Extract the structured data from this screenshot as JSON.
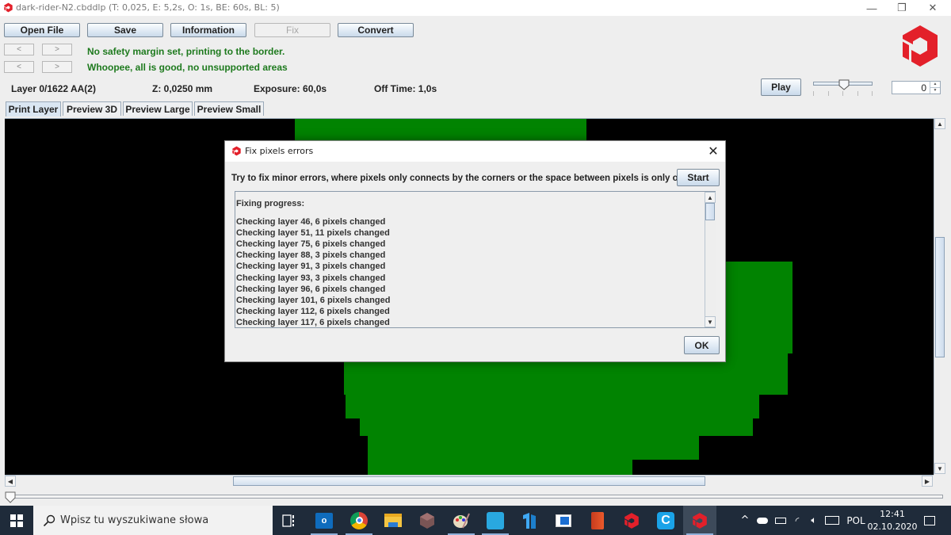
{
  "window": {
    "title": "dark-rider-N2.cbddlp (T: 0,025, E: 5,2s, O: 1s, BE: 60s, BL: 5)",
    "controls": {
      "minimize": "—",
      "maximize": "❐",
      "close": "✕"
    }
  },
  "toolbar": {
    "open_file": "Open File",
    "save": "Save",
    "information": "Information",
    "fix": "Fix",
    "convert": "Convert"
  },
  "nav": {
    "prev": "<",
    "next": ">"
  },
  "messages": {
    "margin": "No safety margin set, printing to the border.",
    "support": "Whoopee, all is good, no unsupported areas"
  },
  "layer_info": {
    "layer": "Layer 0/1622 AA(2)",
    "z": "Z: 0,0250 mm",
    "exposure": "Exposure: 60,0s",
    "off_time": "Off Time: 1,0s"
  },
  "playback": {
    "play_label": "Play",
    "speed_slider_value": 0.5,
    "spinner_value": "0"
  },
  "tabs": [
    {
      "label": "Print Layer",
      "active": true
    },
    {
      "label": "Preview 3D",
      "active": false
    },
    {
      "label": "Preview Large",
      "active": false
    },
    {
      "label": "Preview Small",
      "active": false
    }
  ],
  "colors": {
    "layer_fill": "#018301",
    "background": "#000000",
    "brand_red": "#e3202a",
    "message_green": "#1e7a1e"
  },
  "layer_slider_value": 0,
  "dialog": {
    "title": "Fix pixels errors",
    "description": "Try to fix minor errors, where pixels only connects by the corners or the space between pixels is only one pixel.",
    "start_label": "Start",
    "ok_label": "OK",
    "log_header": "Fixing progress:",
    "log": [
      "Checking layer 46, 6 pixels changed",
      "Checking layer 51, 11 pixels changed",
      "Checking layer 75, 6 pixels changed",
      "Checking layer 88, 3 pixels changed",
      "Checking layer 91, 3 pixels changed",
      "Checking layer 93, 3 pixels changed",
      "Checking layer 96, 6 pixels changed",
      "Checking layer 101, 6 pixels changed",
      "Checking layer 112, 6 pixels changed",
      "Checking layer 117, 6 pixels changed"
    ]
  },
  "taskbar": {
    "search_placeholder": "Wpisz tu wyszukiwane słowa",
    "apps": [
      "task-view",
      "outlook",
      "chrome",
      "file-explorer",
      "3d-app",
      "paint",
      "sketch-app",
      "finder-app",
      "window-app",
      "office",
      "chitubox",
      "c-app",
      "chitubox-active"
    ],
    "language": "POL",
    "time": "12:41",
    "date": "02.10.2020"
  }
}
